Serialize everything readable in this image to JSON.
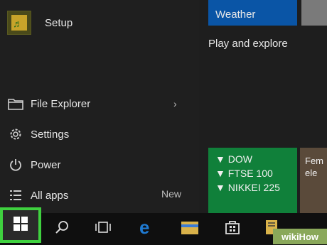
{
  "left": {
    "setup_label": "Setup",
    "items": [
      {
        "label": "File Explorer",
        "icon": "folder-icon"
      },
      {
        "label": "Settings",
        "icon": "gear-icon"
      },
      {
        "label": "Power",
        "icon": "power-icon"
      },
      {
        "label": "All apps",
        "icon": "list-icon"
      }
    ],
    "new_label": "New"
  },
  "tiles": {
    "weather": "Weather",
    "play_explore": "Play and explore",
    "money_lines": [
      "▼ DOW",
      "▼ FTSE 100",
      "▼ NIKKEI 225"
    ],
    "news_text": "Fem\nele"
  },
  "taskbar": {
    "icons": [
      "windows-start-icon",
      "search-icon",
      "task-view-icon",
      "edge-icon",
      "file-explorer-icon",
      "store-icon"
    ]
  },
  "watermark": "wikiHow",
  "colors": {
    "start_highlight": "#3fd13f",
    "weather_tile": "#0a55a6",
    "money_tile": "#10803a"
  }
}
